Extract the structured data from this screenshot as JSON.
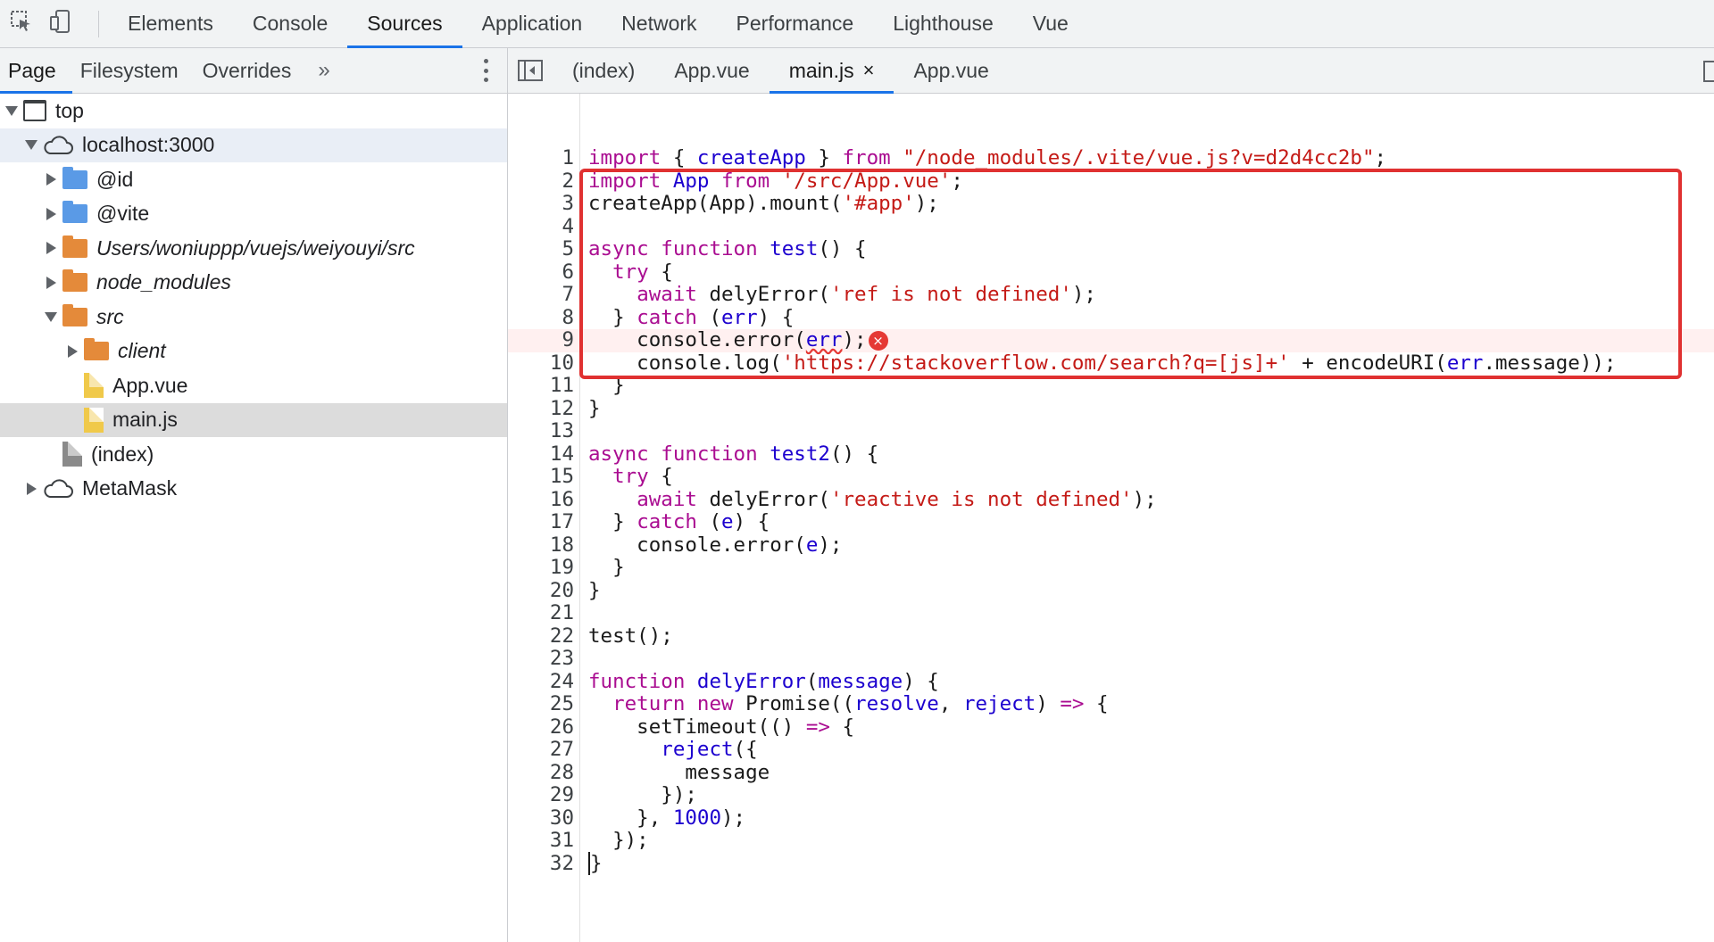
{
  "toolbar": {
    "tabs": [
      "Elements",
      "Console",
      "Sources",
      "Application",
      "Network",
      "Performance",
      "Lighthouse",
      "Vue"
    ],
    "active_tab": "Sources"
  },
  "navigator": {
    "tabs": [
      "Page",
      "Filesystem",
      "Overrides"
    ],
    "more": "»",
    "tree": [
      {
        "label": "top",
        "depth": 0,
        "expanded": true,
        "icon": "frame-icon"
      },
      {
        "label": "localhost:3000",
        "depth": 1,
        "expanded": true,
        "icon": "cloud-icon"
      },
      {
        "label": "@id",
        "depth": 2,
        "expanded": false,
        "icon": "folder-icon"
      },
      {
        "label": "@vite",
        "depth": 2,
        "expanded": false,
        "icon": "folder-icon"
      },
      {
        "label": "Users/woniuppp/vuejs/weiyouyi/src",
        "depth": 2,
        "expanded": false,
        "icon": "folder-icon"
      },
      {
        "label": "node_modules",
        "depth": 2,
        "expanded": false,
        "icon": "folder-icon"
      },
      {
        "label": "src",
        "depth": 2,
        "expanded": true,
        "icon": "folder-icon"
      },
      {
        "label": "client",
        "depth": 3,
        "expanded": false,
        "icon": "folder-icon"
      },
      {
        "label": "App.vue",
        "depth": 3,
        "icon": "file-icon"
      },
      {
        "label": "main.js",
        "depth": 3,
        "icon": "file-icon",
        "selected": true
      },
      {
        "label": "(index)",
        "depth": 2,
        "icon": "file-icon"
      },
      {
        "label": "MetaMask",
        "depth": 1,
        "expanded": false,
        "icon": "cloud-icon"
      }
    ]
  },
  "editor": {
    "tabs": [
      {
        "label": "(index)"
      },
      {
        "label": "App.vue"
      },
      {
        "label": "main.js",
        "active": true,
        "close": "×"
      },
      {
        "label": "App.vue"
      }
    ],
    "line_numbers": [
      "1",
      "2",
      "3",
      "4",
      "5",
      "6",
      "7",
      "8",
      "9",
      "10",
      "11",
      "12",
      "13",
      "14",
      "15",
      "16",
      "17",
      "18",
      "19",
      "20",
      "21",
      "22",
      "23",
      "24",
      "25",
      "26",
      "27",
      "28",
      "29",
      "30",
      "31",
      "32"
    ],
    "error_line": 9,
    "error_mark": "×",
    "code": [
      [
        [
          "k",
          "import"
        ],
        [
          "p",
          " { "
        ],
        [
          "f",
          "createApp"
        ],
        [
          "p",
          " } "
        ],
        [
          "k",
          "from"
        ],
        [
          "p",
          " "
        ],
        [
          "s",
          "\"/node_modules/.vite/vue.js?v=d2d4cc2b\""
        ],
        [
          "p",
          ";"
        ]
      ],
      [
        [
          "k",
          "import"
        ],
        [
          "p",
          " "
        ],
        [
          "f",
          "App"
        ],
        [
          "p",
          " "
        ],
        [
          "k",
          "from"
        ],
        [
          "p",
          " "
        ],
        [
          "s",
          "'/src/App.vue'"
        ],
        [
          "p",
          ";"
        ]
      ],
      [
        [
          "p",
          "createApp(App).mount("
        ],
        [
          "s",
          "'#app'"
        ],
        [
          "p",
          ");"
        ]
      ],
      [],
      [
        [
          "k",
          "async function"
        ],
        [
          "p",
          " "
        ],
        [
          "f",
          "test"
        ],
        [
          "p",
          "() {"
        ]
      ],
      [
        [
          "p",
          "  "
        ],
        [
          "k",
          "try"
        ],
        [
          "p",
          " {"
        ]
      ],
      [
        [
          "p",
          "    "
        ],
        [
          "k",
          "await"
        ],
        [
          "p",
          " delyError("
        ],
        [
          "s",
          "'ref is not defined'"
        ],
        [
          "p",
          ");"
        ]
      ],
      [
        [
          "p",
          "  } "
        ],
        [
          "k",
          "catch"
        ],
        [
          "p",
          " ("
        ],
        [
          "f",
          "err"
        ],
        [
          "p",
          ") {"
        ]
      ],
      [
        [
          "p",
          "    console.error("
        ],
        [
          "f",
          "err"
        ],
        [
          "p",
          ");"
        ]
      ],
      [
        [
          "p",
          "    console.log("
        ],
        [
          "s",
          "'https://stackoverflow.com/search?q=[js]+'"
        ],
        [
          "p",
          " + encodeURI("
        ],
        [
          "f",
          "err"
        ],
        [
          "p",
          ".message));"
        ]
      ],
      [
        [
          "p",
          "  }"
        ]
      ],
      [
        [
          "p",
          "}"
        ]
      ],
      [],
      [
        [
          "k",
          "async function"
        ],
        [
          "p",
          " "
        ],
        [
          "f",
          "test2"
        ],
        [
          "p",
          "() {"
        ]
      ],
      [
        [
          "p",
          "  "
        ],
        [
          "k",
          "try"
        ],
        [
          "p",
          " {"
        ]
      ],
      [
        [
          "p",
          "    "
        ],
        [
          "k",
          "await"
        ],
        [
          "p",
          " delyError("
        ],
        [
          "s",
          "'reactive is not defined'"
        ],
        [
          "p",
          ");"
        ]
      ],
      [
        [
          "p",
          "  } "
        ],
        [
          "k",
          "catch"
        ],
        [
          "p",
          " ("
        ],
        [
          "f",
          "e"
        ],
        [
          "p",
          ") {"
        ]
      ],
      [
        [
          "p",
          "    console.error("
        ],
        [
          "f",
          "e"
        ],
        [
          "p",
          ");"
        ]
      ],
      [
        [
          "p",
          "  }"
        ]
      ],
      [
        [
          "p",
          "}"
        ]
      ],
      [],
      [
        [
          "p",
          "test();"
        ]
      ],
      [],
      [
        [
          "k",
          "function"
        ],
        [
          "p",
          " "
        ],
        [
          "f",
          "delyError"
        ],
        [
          "p",
          "("
        ],
        [
          "f",
          "message"
        ],
        [
          "p",
          ") {"
        ]
      ],
      [
        [
          "p",
          "  "
        ],
        [
          "k",
          "return new"
        ],
        [
          "p",
          " Promise(("
        ],
        [
          "f",
          "resolve"
        ],
        [
          "p",
          ", "
        ],
        [
          "f",
          "reject"
        ],
        [
          "p",
          ") "
        ],
        [
          "k",
          "=>"
        ],
        [
          "p",
          " {"
        ]
      ],
      [
        [
          "p",
          "    setTimeout(() "
        ],
        [
          "k",
          "=>"
        ],
        [
          "p",
          " {"
        ]
      ],
      [
        [
          "p",
          "      "
        ],
        [
          "f",
          "reject"
        ],
        [
          "p",
          "({"
        ]
      ],
      [
        [
          "p",
          "        message"
        ]
      ],
      [
        [
          "p",
          "      });"
        ]
      ],
      [
        [
          "p",
          "    }, "
        ],
        [
          "v",
          "1000"
        ],
        [
          "p",
          ");"
        ]
      ],
      [
        [
          "p",
          "  });"
        ]
      ],
      [
        [
          "p",
          "}"
        ]
      ]
    ]
  }
}
